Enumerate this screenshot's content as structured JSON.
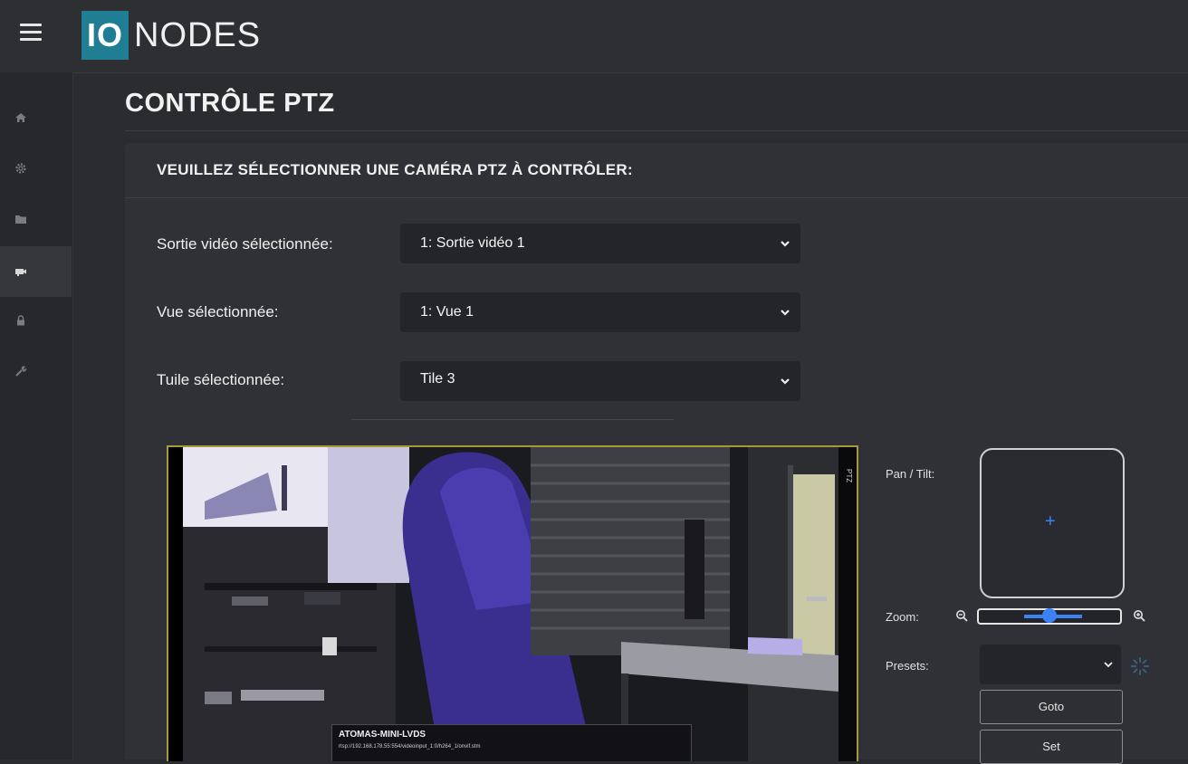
{
  "brand": {
    "io": "IO",
    "name": "NODES",
    "accent": "#1f7e93"
  },
  "sidebar": {
    "items": [
      {
        "icon": "home-icon",
        "active": false
      },
      {
        "icon": "gear-icon",
        "active": false
      },
      {
        "icon": "folder-icon",
        "active": false
      },
      {
        "icon": "camera-icon",
        "active": true
      },
      {
        "icon": "lock-icon",
        "active": false
      },
      {
        "icon": "wrench-icon",
        "active": false
      }
    ]
  },
  "page": {
    "title": "CONTRÔLE PTZ"
  },
  "panel": {
    "header": "VEUILLEZ SÉLECTIONNER UNE CAMÉRA PTZ À CONTRÔLER:",
    "fields": {
      "video_output": {
        "label": "Sortie vidéo sélectionnée:",
        "value": "1: Sortie vidéo 1"
      },
      "view": {
        "label": "Vue sélectionnée:",
        "value": "1: Vue 1"
      },
      "tile": {
        "label": "Tuile sélectionnée:",
        "value": "Tile 3"
      }
    }
  },
  "video": {
    "camera_name": "ATOMAS-MINI-LVDS",
    "stream_url": "rtsp://192.168.178.55:554/videoinput_1:0/h264_1/onvif.stm",
    "ptz_tag": "PTZ"
  },
  "controls": {
    "pan_tilt_label": "Pan / Tilt:",
    "zoom_label": "Zoom:",
    "zoom_level": 0.5,
    "presets_label": "Presets:",
    "preset_value": "",
    "goto_label": "Goto",
    "set_label": "Set",
    "accent": "#3b82f6"
  }
}
